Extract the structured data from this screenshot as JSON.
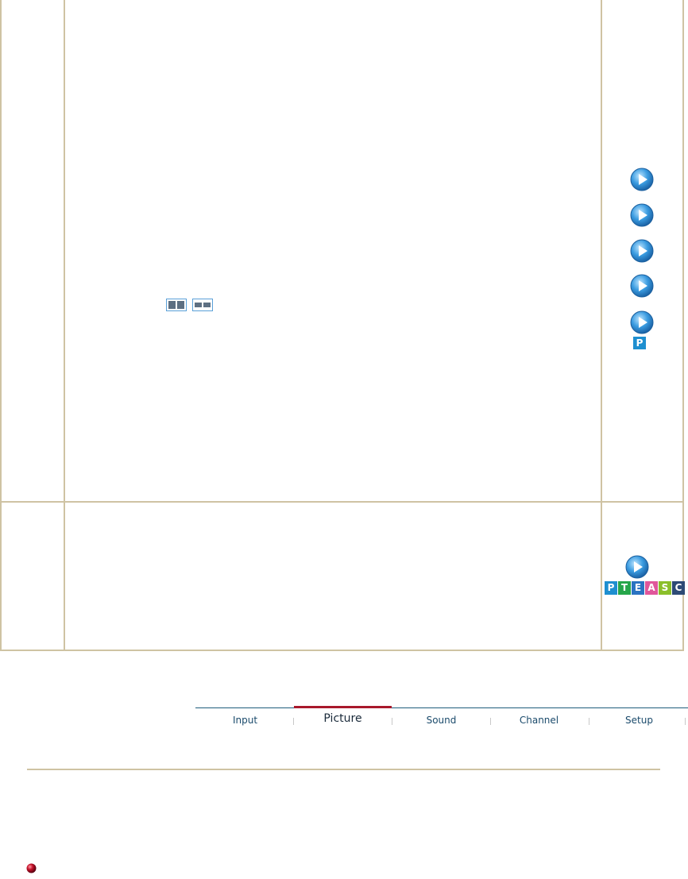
{
  "content_table": {
    "row1": {
      "icons": [
        "play-circle-icon",
        "play-circle-icon",
        "play-circle-icon",
        "play-circle-icon",
        "play-circle-icon"
      ],
      "badge": "P",
      "screen_mode_icons": [
        "split-screen-vertical-icon",
        "split-screen-horizontal-icon"
      ]
    },
    "row2": {
      "icon": "play-circle-icon",
      "badges": [
        {
          "letter": "P",
          "color": "#1e8fd0"
        },
        {
          "letter": "T",
          "color": "#26a64a"
        },
        {
          "letter": "E",
          "color": "#2a73c2"
        },
        {
          "letter": "A",
          "color": "#e0569a"
        },
        {
          "letter": "S",
          "color": "#8bbf2a"
        },
        {
          "letter": "C",
          "color": "#2d4a75"
        }
      ]
    }
  },
  "nav": {
    "tabs": [
      {
        "label": "Input"
      },
      {
        "label": "Picture"
      },
      {
        "label": "Sound"
      },
      {
        "label": "Channel"
      },
      {
        "label": "Setup"
      }
    ],
    "active_tab": "Picture",
    "accent_color": "#a8182b",
    "line_color": "#1f5d7c"
  },
  "footer": {
    "bullet_icon": "red-sphere-bullet-icon"
  },
  "colors": {
    "border": "#cfc3a3",
    "play_icon": "#2b8fd6"
  }
}
